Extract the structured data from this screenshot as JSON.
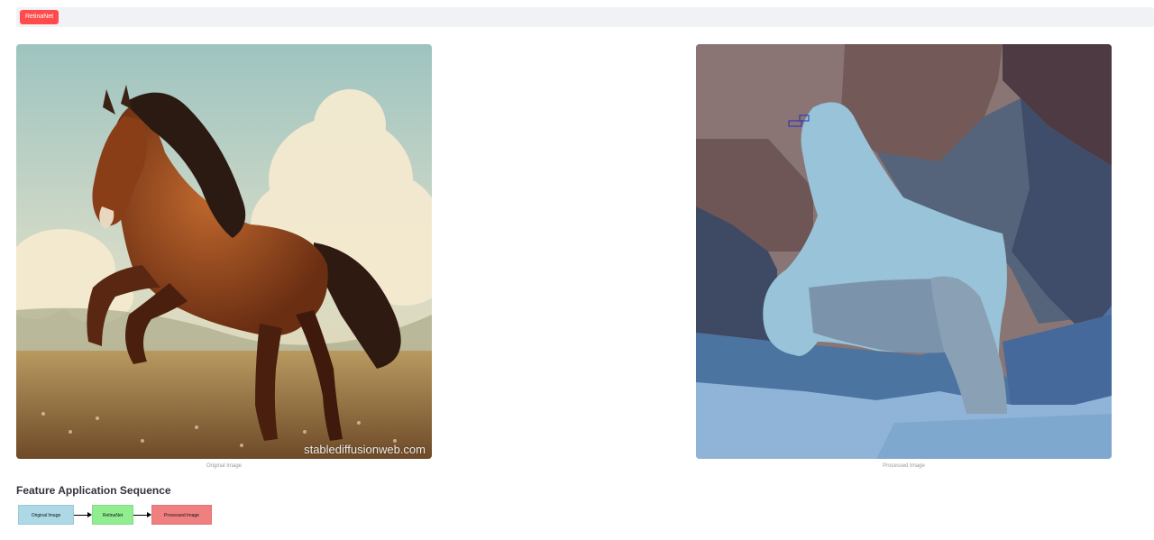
{
  "toolbar": {
    "model_label": "RetinaNet"
  },
  "images": {
    "original": {
      "caption": "Original Image",
      "watermark": "stablediffusionweb.com"
    },
    "processed": {
      "caption": "Processed Image"
    }
  },
  "sequence": {
    "title": "Feature Application Sequence",
    "steps": [
      "Original Image",
      "RetinaNet",
      "Processed Image"
    ]
  },
  "colors": {
    "accent": "#ff4b4b",
    "step_original": "#add8e6",
    "step_model": "#90ee90",
    "step_processed": "#f08080"
  }
}
